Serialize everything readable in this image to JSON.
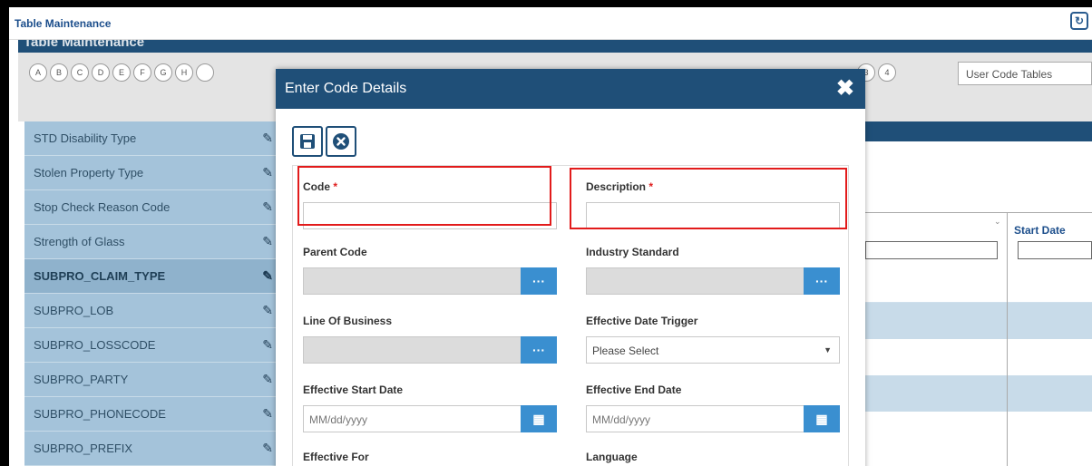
{
  "window": {
    "title": "Table Maintenance"
  },
  "page": {
    "header": "Table Maintenance"
  },
  "alphabet": [
    "A",
    "B",
    "C",
    "D",
    "E",
    "F",
    "G",
    "H"
  ],
  "alphabet_tail": [
    "3",
    "4"
  ],
  "table_selector": {
    "value": "User Code Tables"
  },
  "left_list": [
    "STD Disability Type",
    "Stolen Property Type",
    "Stop Check Reason Code",
    "Strength of Glass",
    "SUBPRO_CLAIM_TYPE",
    "SUBPRO_LOB",
    "SUBPRO_LOSSCODE",
    "SUBPRO_PARTY",
    "SUBPRO_PHONECODE",
    "SUBPRO_PREFIX"
  ],
  "right_grid": {
    "column_start_date": "Start Date"
  },
  "modal": {
    "title": "Enter Code Details",
    "close_glyph": "✖",
    "fields": {
      "code": {
        "label": "Code",
        "required": "*",
        "value": ""
      },
      "description": {
        "label": "Description",
        "required": "*",
        "value": ""
      },
      "parent_code": {
        "label": "Parent Code",
        "value": ""
      },
      "industry_standard": {
        "label": "Industry Standard",
        "value": ""
      },
      "line_of_business": {
        "label": "Line Of Business",
        "value": ""
      },
      "effective_date_trigger": {
        "label": "Effective Date Trigger",
        "value": "Please Select"
      },
      "effective_start_date": {
        "label": "Effective Start Date",
        "placeholder": "MM/dd/yyyy"
      },
      "effective_end_date": {
        "label": "Effective End Date",
        "placeholder": "MM/dd/yyyy"
      },
      "effective_for": {
        "label": "Effective For"
      },
      "language": {
        "label": "Language"
      }
    },
    "lookup_glyph": "···",
    "calendar_glyph": "▦"
  },
  "colors": {
    "header_blue": "#1f4f78",
    "list_blue": "#a4c3da",
    "addon_blue": "#3a8fd0",
    "highlight_red": "#e21b1b",
    "required_red": "#e02020"
  }
}
